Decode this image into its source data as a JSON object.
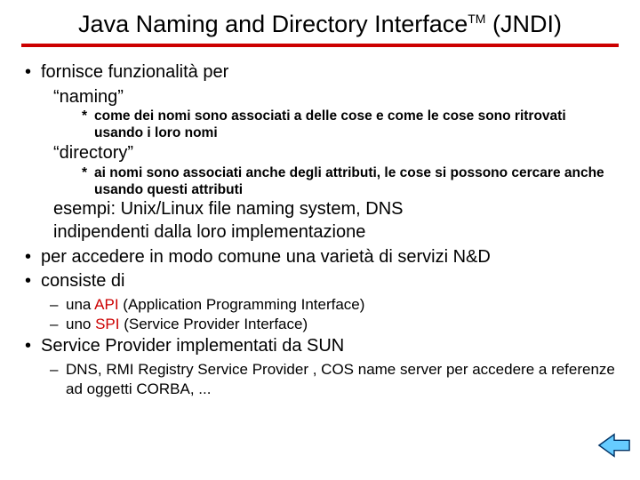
{
  "title_pre": "Java Naming and Directory Interface",
  "title_tm": "TM",
  "title_post": " (JNDI)",
  "b1_fornisce": "fornisce funzionalità per",
  "naming_label": "“naming”",
  "naming_desc": "come dei nomi sono associati a delle cose e come le cose sono ritrovati usando i loro nomi",
  "directory_label": "“directory”",
  "directory_desc": "ai nomi sono associati anche degli attributi, le cose si possono cercare anche usando questi attributi",
  "esempi": "esempi: Unix/Linux file naming system, DNS",
  "indipendenti": "indipendenti dalla loro implementazione",
  "accedere": "per accedere in modo comune una varietà di servizi N&D",
  "consiste": "consiste di",
  "api_pre": "una ",
  "api_red": "API",
  "api_post": " (Application Programming Interface)",
  "spi_pre": "uno ",
  "spi_red": "SPI",
  "spi_post": " (Service Provider Interface)",
  "provider": "Service Provider implementati da SUN",
  "provider_list": "DNS, RMI Registry Service Provider , COS name server per accedere a referenze ad oggetti CORBA, ..."
}
